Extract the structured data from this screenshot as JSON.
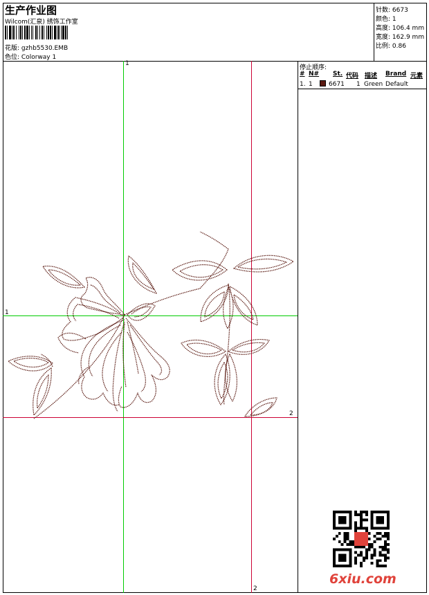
{
  "header": {
    "title": "生产作业图",
    "studio": "Wilcom(汇泉) 绣饰工作室",
    "design_label": "花版:",
    "design_value": "gzhb5530.EMB",
    "colorway_label": "色位:",
    "colorway_value": "Colorway 1"
  },
  "stats": {
    "stitches_label": "针数:",
    "stitches_value": "6673",
    "colors_label": "颜色:",
    "colors_value": "1",
    "height_label": "高度:",
    "height_value": "106.4 mm",
    "width_label": "宽度:",
    "width_value": "162.9 mm",
    "scale_label": "比例:",
    "scale_value": "0.86"
  },
  "stop_sequence": {
    "title": "停止顺序:",
    "headers": [
      "#",
      "N#",
      "St.",
      "代码",
      "描述",
      "Brand",
      "元素"
    ],
    "rows": [
      {
        "index": "1.",
        "n": "1",
        "swatch_color": "#5a1a12",
        "stitches": "6671",
        "code": "1",
        "description": "Green",
        "brand": "Default"
      }
    ]
  },
  "guides": {
    "top_label": "1",
    "left_label": "1",
    "right_label": "2",
    "bottom_label": "2",
    "green_color": "#00cc00",
    "red_color": "#cc0033"
  },
  "thread_color": "#5a1a12",
  "watermark": "6xiu.com"
}
